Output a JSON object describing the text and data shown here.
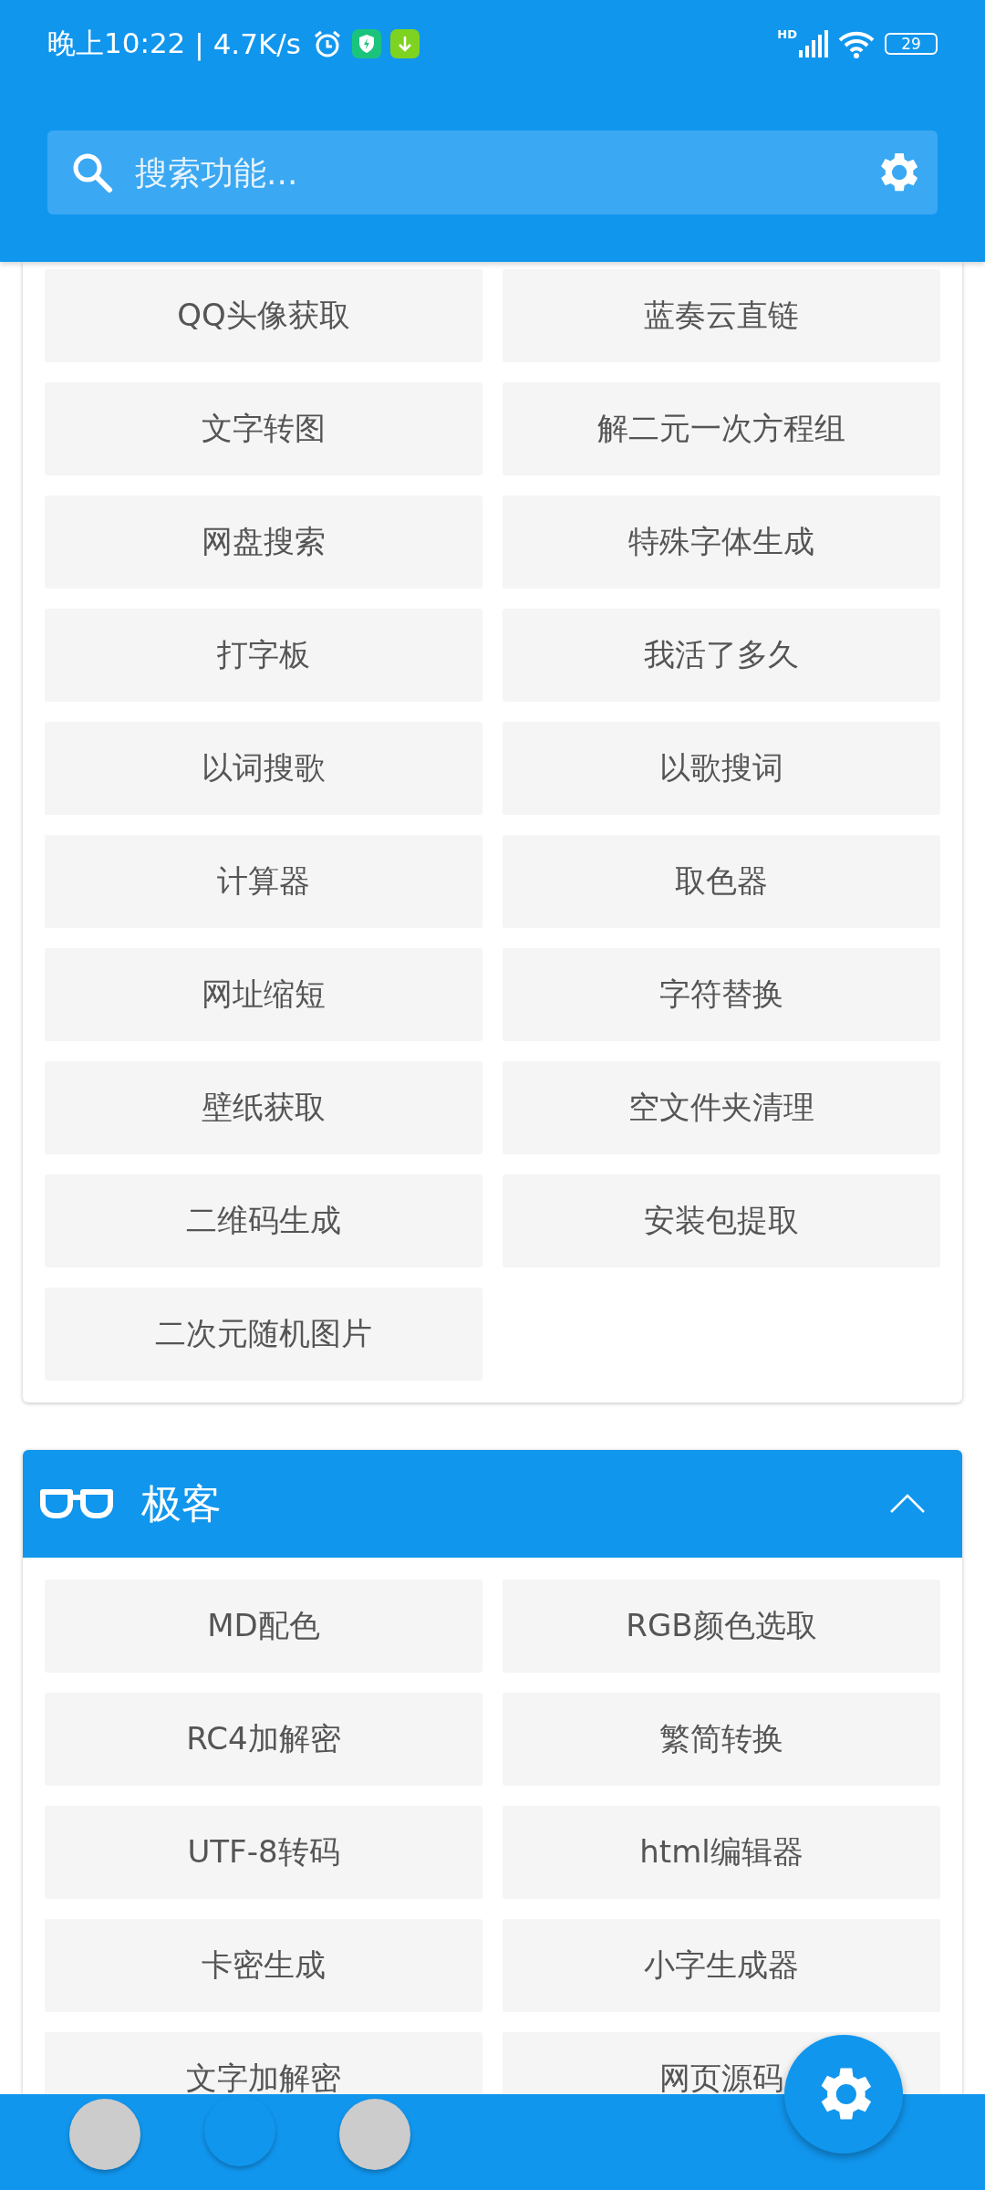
{
  "status_bar": {
    "time": "晚上10:22",
    "speed": "| 4.7K/s",
    "signal_label": "HD",
    "battery": "29"
  },
  "search": {
    "placeholder": "搜索功能..."
  },
  "sections": [
    {
      "items": [
        "QQ头像获取",
        "蓝奏云直链",
        "文字转图",
        "解二元一次方程组",
        "网盘搜索",
        "特殊字体生成",
        "打字板",
        "我活了多久",
        "以词搜歌",
        "以歌搜词",
        "计算器",
        "取色器",
        "网址缩短",
        "字符替换",
        "壁纸获取",
        "空文件夹清理",
        "二维码生成",
        "安装包提取",
        "二次元随机图片"
      ]
    },
    {
      "title": "极客",
      "expanded": true,
      "items": [
        "MD配色",
        "RGB颜色选取",
        "RC4加解密",
        "繁简转换",
        "UTF-8转码",
        "html编辑器",
        "卡密生成",
        "小字生成器",
        "文字加解密",
        "网页源码"
      ]
    }
  ],
  "pages": [
    {
      "selected": false
    },
    {
      "selected": true
    },
    {
      "selected": false
    }
  ]
}
